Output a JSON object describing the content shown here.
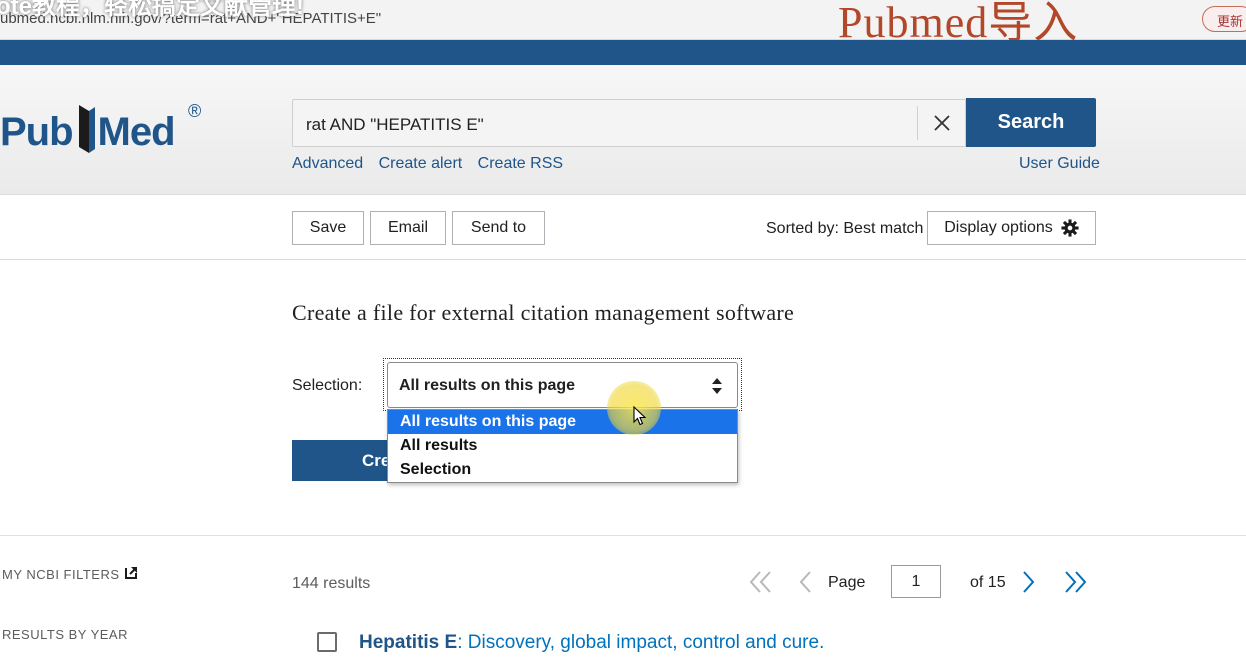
{
  "overlay": {
    "caption": "ote教程，轻松搞定文献管理!",
    "brand": "Pubmed导入",
    "update_badge": "更新"
  },
  "browser": {
    "url": "ubmed.ncbi.nlm.nih.gov/?term=rat+AND+\"HEPATITIS+E\""
  },
  "header": {
    "logo_text_left": "Pub",
    "logo_text_right": "Med",
    "logo_reg": "®",
    "search_value": "rat AND \"HEPATITIS E\"",
    "search_button": "Search",
    "links": [
      "Advanced",
      "Create alert",
      "Create RSS"
    ],
    "user_guide": "User Guide"
  },
  "toolbar": {
    "save": "Save",
    "email": "Email",
    "send_to": "Send to",
    "sorted_by": "Sorted by: Best match",
    "display_options": "Display options"
  },
  "citation_panel": {
    "title": "Create a file for external citation management software",
    "selection_label": "Selection:",
    "selected_value": "All results on this page",
    "options": [
      "All results on this page",
      "All results",
      "Selection"
    ],
    "active_option_index": 0,
    "create_button_visible": "Cre"
  },
  "sidebar": {
    "my_ncbi_filters": "MY NCBI FILTERS",
    "results_by_year": "RESULTS BY YEAR"
  },
  "results": {
    "count": "144 results",
    "page_label": "Page",
    "page_value": "1",
    "of_pages": "of 15",
    "first_item": {
      "title_highlight": "Hepatitis E",
      "title_rest": ": Discovery, global impact, control and cure."
    }
  },
  "colors": {
    "brand_blue": "#20558a",
    "link_blue": "#0071bc",
    "dropdown_active": "#1a73e8"
  }
}
